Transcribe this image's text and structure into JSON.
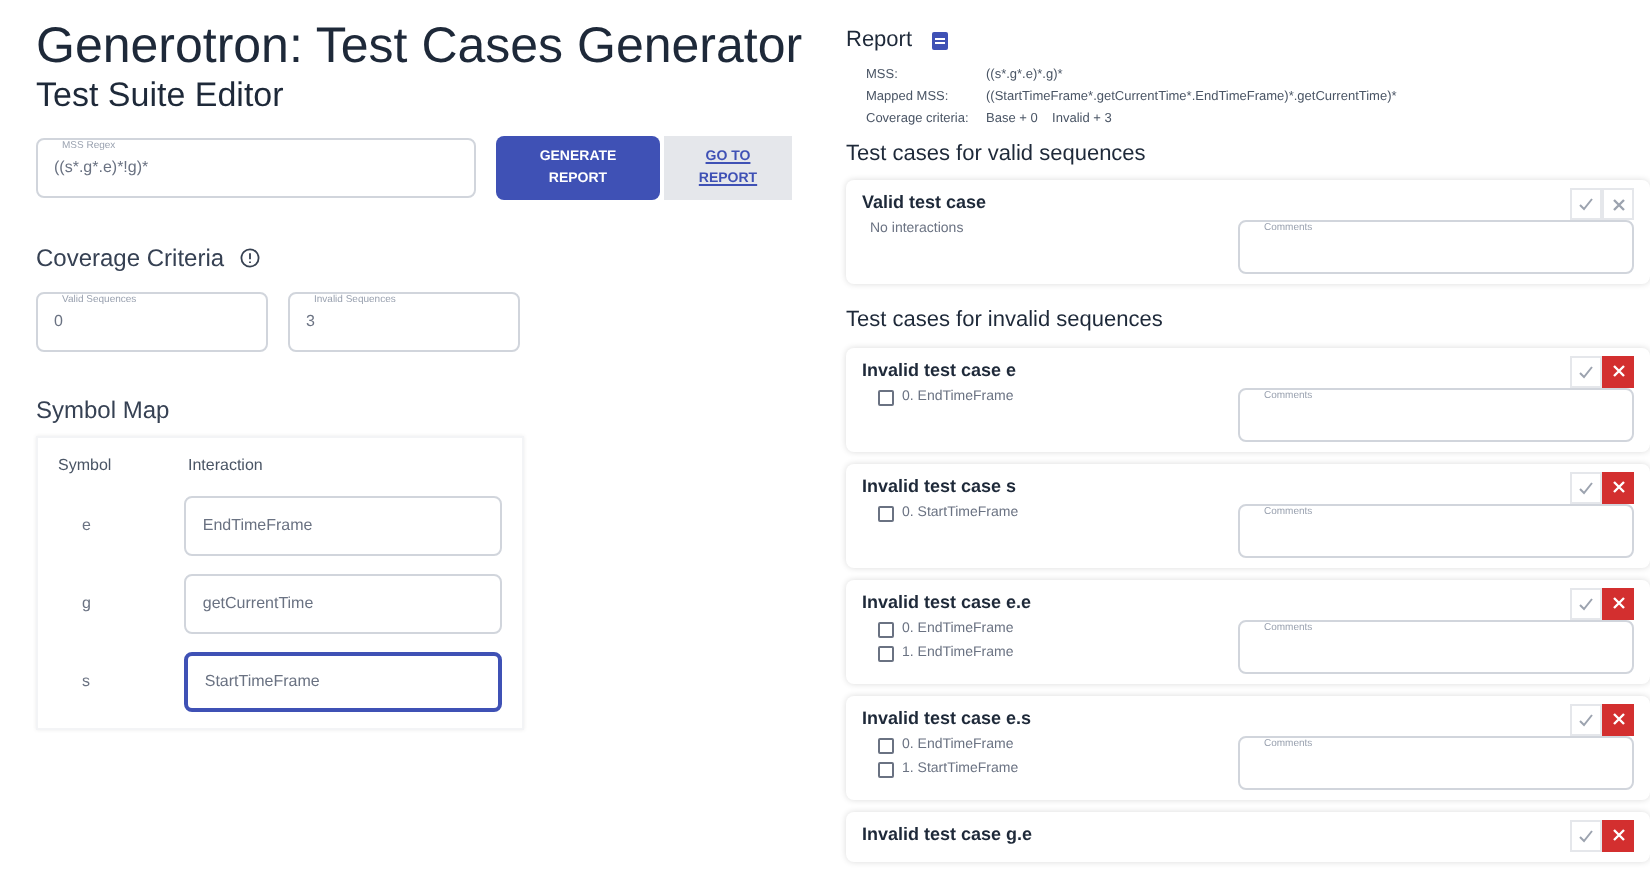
{
  "title": "Generotron: Test Cases Generator",
  "subtitle": "Test Suite Editor",
  "regex": {
    "label": "MSS Regex",
    "value": "((s*.g*.e)*!g)*"
  },
  "buttons": [
    {
      "label": "GENERATE REPORT",
      "kind": "primary"
    },
    {
      "label": "GO TO REPORT",
      "kind": "link"
    }
  ],
  "coverage": {
    "title": "Coverage Criteria",
    "fields": [
      {
        "label": "Valid Sequences",
        "value": "0"
      },
      {
        "label": "Invalid Sequences",
        "value": "3"
      }
    ]
  },
  "symbol_map": {
    "title": "Symbol Map",
    "columns": [
      "Symbol",
      "Interaction"
    ],
    "rows": [
      {
        "symbol": "e",
        "interaction": "EndTimeFrame",
        "focused": false
      },
      {
        "symbol": "g",
        "interaction": "getCurrentTime",
        "focused": false
      },
      {
        "symbol": "s",
        "interaction": "StartTimeFrame",
        "focused": true
      }
    ]
  },
  "report": {
    "title": "Report",
    "info": [
      {
        "label": "MSS:",
        "value": "((s*.g*.e)*.g)*"
      },
      {
        "label": "Mapped MSS:",
        "value": "((StartTimeFrame*.getCurrentTime*.EndTimeFrame)*.getCurrentTime)*"
      },
      {
        "label": "Coverage criteria:",
        "value": "Base + 0    Invalid + 3"
      }
    ]
  },
  "valid_section": {
    "title": "Test cases for valid sequences",
    "cases": [
      {
        "title": "Valid test case",
        "empty_text": "No interactions",
        "comments_label": "Comments",
        "rejected": false
      }
    ]
  },
  "invalid_section": {
    "title": "Test cases for invalid sequences",
    "cases": [
      {
        "title": "Invalid test case e",
        "comments_label": "Comments",
        "rejected": true,
        "steps": [
          {
            "label": "0. EndTimeFrame",
            "checked": false
          }
        ]
      },
      {
        "title": "Invalid test case s",
        "comments_label": "Comments",
        "rejected": true,
        "steps": [
          {
            "label": "0. StartTimeFrame",
            "checked": false
          }
        ]
      },
      {
        "title": "Invalid test case e.e",
        "comments_label": "Comments",
        "rejected": true,
        "steps": [
          {
            "label": "0. EndTimeFrame",
            "checked": false
          },
          {
            "label": "1. EndTimeFrame",
            "checked": false
          }
        ]
      },
      {
        "title": "Invalid test case e.s",
        "comments_label": "Comments",
        "rejected": true,
        "steps": [
          {
            "label": "0. EndTimeFrame",
            "checked": false
          },
          {
            "label": "1. StartTimeFrame",
            "checked": false
          }
        ]
      },
      {
        "title": "Invalid test case g.e",
        "rejected": true
      }
    ]
  }
}
